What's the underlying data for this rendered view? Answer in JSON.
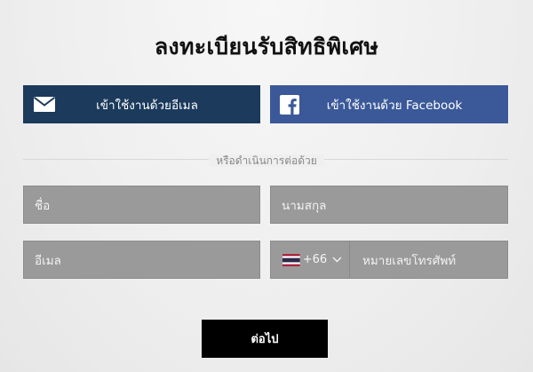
{
  "page": {
    "title": "ลงทะเบียนรับสิทธิพิเศษ"
  },
  "social": {
    "email_label": "เข้าใช้งานด้วยอีเมล",
    "facebook_label": "เข้าใช้งานด้วย Facebook",
    "email_icon": "envelope-icon",
    "facebook_icon": "facebook-icon",
    "email_color": "#1b3a5c",
    "facebook_color": "#3b5998"
  },
  "divider": {
    "text": "หรือดำเนินการต่อด้วย"
  },
  "form": {
    "first_name_placeholder": "ชื่อ",
    "last_name_placeholder": "นามสกุล",
    "email_placeholder": "อีเมล",
    "country_code": "+66",
    "country_flag": "thailand-flag-icon",
    "phone_placeholder": "หมายเลขโทรศัพท์"
  },
  "actions": {
    "continue_label": "ต่อไป"
  }
}
